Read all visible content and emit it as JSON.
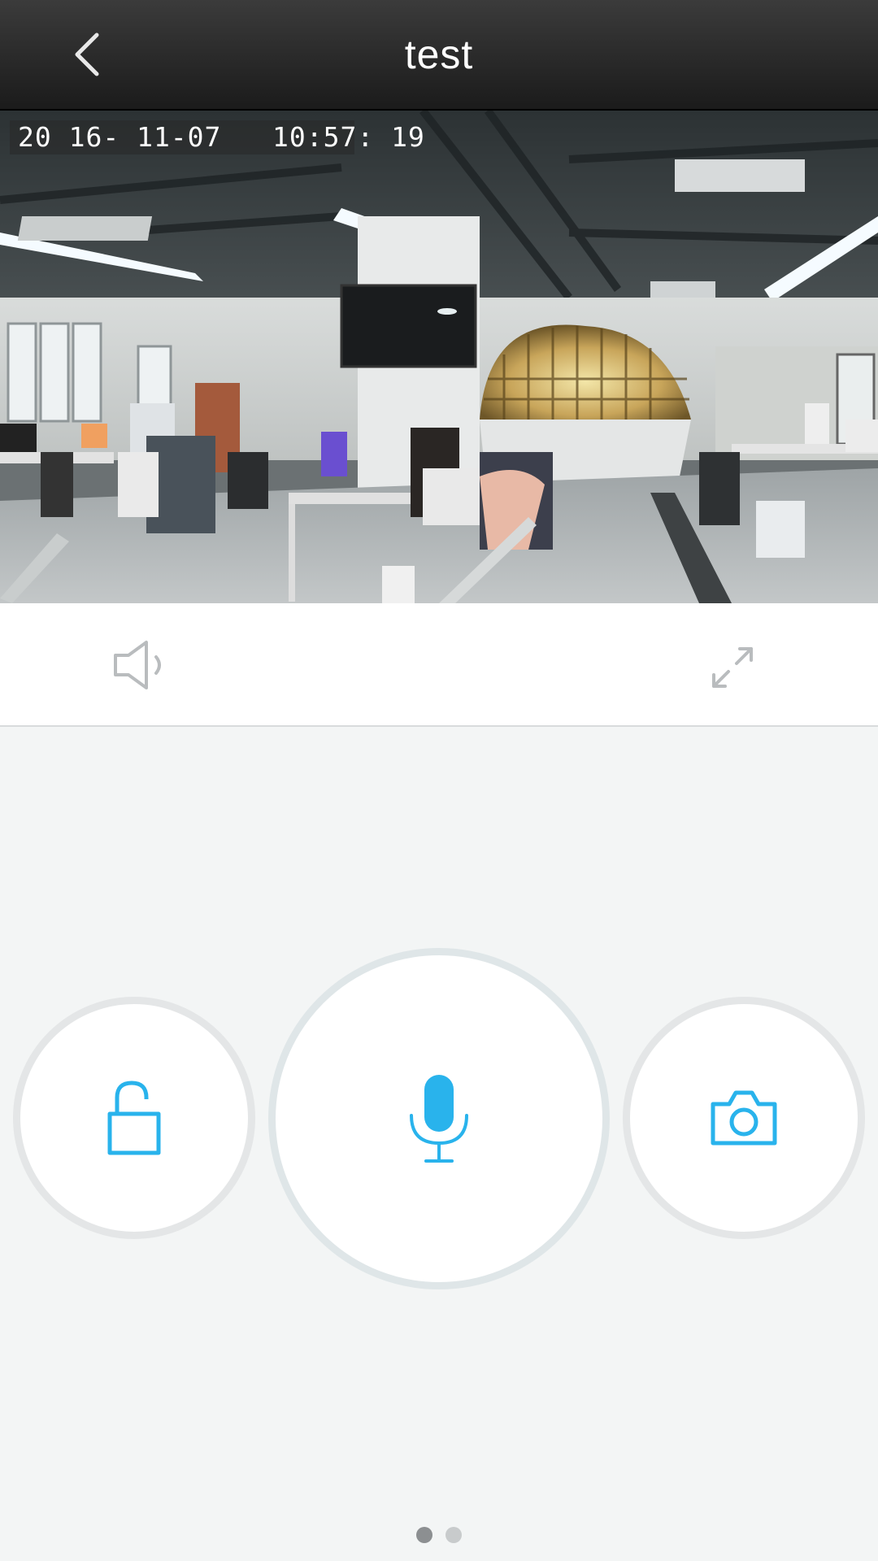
{
  "header": {
    "title": "test",
    "back_icon": "chevron-left-icon"
  },
  "video": {
    "timestamp": "20 16- 11-07   10:57: 19"
  },
  "controls": {
    "volume_icon": "speaker-icon",
    "fullscreen_icon": "expand-icon"
  },
  "actions": [
    {
      "name": "unlock",
      "icon": "unlock-icon"
    },
    {
      "name": "talk",
      "icon": "microphone-icon"
    },
    {
      "name": "snapshot",
      "icon": "camera-icon"
    }
  ],
  "pager": {
    "count": 2,
    "active_index": 0
  },
  "colors": {
    "accent": "#29b3ec",
    "header_bg": "#2a2a2a",
    "background": "#f3f5f5",
    "icon_gray": "#b9bcbe"
  }
}
